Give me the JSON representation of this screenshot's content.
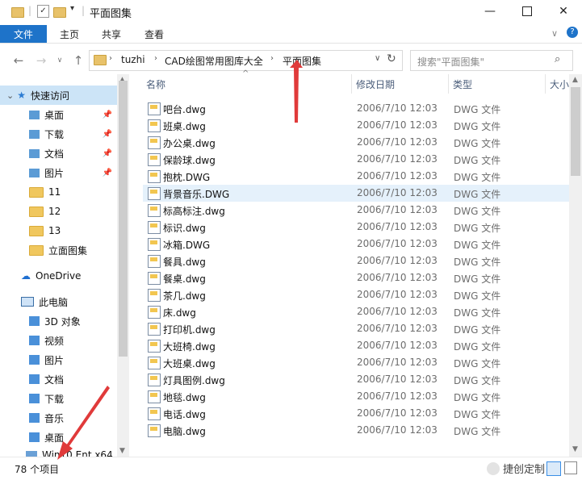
{
  "window": {
    "title": "平面图集",
    "minimize_icon": "minimize-icon",
    "maximize_icon": "maximize-icon",
    "close_icon": "close-icon"
  },
  "ribbon": {
    "tabs": [
      "文件",
      "主页",
      "共享",
      "查看"
    ]
  },
  "address": {
    "path": [
      "tuzhi",
      "CAD绘图常用图库大全",
      "平面图集"
    ],
    "search_placeholder": "搜索\"平面图集\""
  },
  "nav": {
    "quick_access": "快速访问",
    "items": [
      {
        "label": "桌面",
        "icon": "desktop-icon",
        "pinned": true
      },
      {
        "label": "下载",
        "icon": "download-icon",
        "pinned": true
      },
      {
        "label": "文档",
        "icon": "document-icon",
        "pinned": true
      },
      {
        "label": "图片",
        "icon": "pictures-icon",
        "pinned": true
      },
      {
        "label": "11",
        "icon": "folder-icon"
      },
      {
        "label": "12",
        "icon": "folder-icon"
      },
      {
        "label": "13",
        "icon": "folder-icon"
      },
      {
        "label": "立面图集",
        "icon": "folder-icon"
      }
    ],
    "onedrive": "OneDrive",
    "this_pc": "此电脑",
    "pc_items": [
      {
        "label": "3D 对象",
        "icon": "3d-objects-icon"
      },
      {
        "label": "视频",
        "icon": "video-icon"
      },
      {
        "label": "图片",
        "icon": "pictures-icon"
      },
      {
        "label": "文档",
        "icon": "document-icon"
      },
      {
        "label": "下载",
        "icon": "download-icon"
      },
      {
        "label": "音乐",
        "icon": "music-icon"
      },
      {
        "label": "桌面",
        "icon": "desktop-icon"
      }
    ],
    "drive": "Win10 Ent x64"
  },
  "columns": {
    "name": "名称",
    "date": "修改日期",
    "type": "类型",
    "size": "大小"
  },
  "files": [
    {
      "name": "吧台.dwg",
      "date": "2006/7/10 12:03",
      "type": "DWG 文件"
    },
    {
      "name": "班桌.dwg",
      "date": "2006/7/10 12:03",
      "type": "DWG 文件"
    },
    {
      "name": "办公桌.dwg",
      "date": "2006/7/10 12:03",
      "type": "DWG 文件"
    },
    {
      "name": "保龄球.dwg",
      "date": "2006/7/10 12:03",
      "type": "DWG 文件"
    },
    {
      "name": "抱枕.DWG",
      "date": "2006/7/10 12:03",
      "type": "DWG 文件"
    },
    {
      "name": "背景音乐.DWG",
      "date": "2006/7/10 12:03",
      "type": "DWG 文件"
    },
    {
      "name": "标高标注.dwg",
      "date": "2006/7/10 12:03",
      "type": "DWG 文件"
    },
    {
      "name": "标识.dwg",
      "date": "2006/7/10 12:03",
      "type": "DWG 文件"
    },
    {
      "name": "冰箱.DWG",
      "date": "2006/7/10 12:03",
      "type": "DWG 文件"
    },
    {
      "name": "餐具.dwg",
      "date": "2006/7/10 12:03",
      "type": "DWG 文件"
    },
    {
      "name": "餐桌.dwg",
      "date": "2006/7/10 12:03",
      "type": "DWG 文件"
    },
    {
      "name": "茶几.dwg",
      "date": "2006/7/10 12:03",
      "type": "DWG 文件"
    },
    {
      "name": "床.dwg",
      "date": "2006/7/10 12:03",
      "type": "DWG 文件"
    },
    {
      "name": "打印机.dwg",
      "date": "2006/7/10 12:03",
      "type": "DWG 文件"
    },
    {
      "name": "大班椅.dwg",
      "date": "2006/7/10 12:03",
      "type": "DWG 文件"
    },
    {
      "name": "大班桌.dwg",
      "date": "2006/7/10 12:03",
      "type": "DWG 文件"
    },
    {
      "name": "灯具图例.dwg",
      "date": "2006/7/10 12:03",
      "type": "DWG 文件"
    },
    {
      "name": "地毯.dwg",
      "date": "2006/7/10 12:03",
      "type": "DWG 文件"
    },
    {
      "name": "电话.dwg",
      "date": "2006/7/10 12:03",
      "type": "DWG 文件"
    },
    {
      "name": "电脑.dwg",
      "date": "2006/7/10 12:03",
      "type": "DWG 文件"
    }
  ],
  "status": {
    "count": "78 个项目"
  },
  "watermark": "捷创定制",
  "colors": {
    "accent": "#1e73c9",
    "selected": "#cce4f7",
    "hover_row": "#e5f1fb",
    "arrow": "#e03a3a"
  }
}
